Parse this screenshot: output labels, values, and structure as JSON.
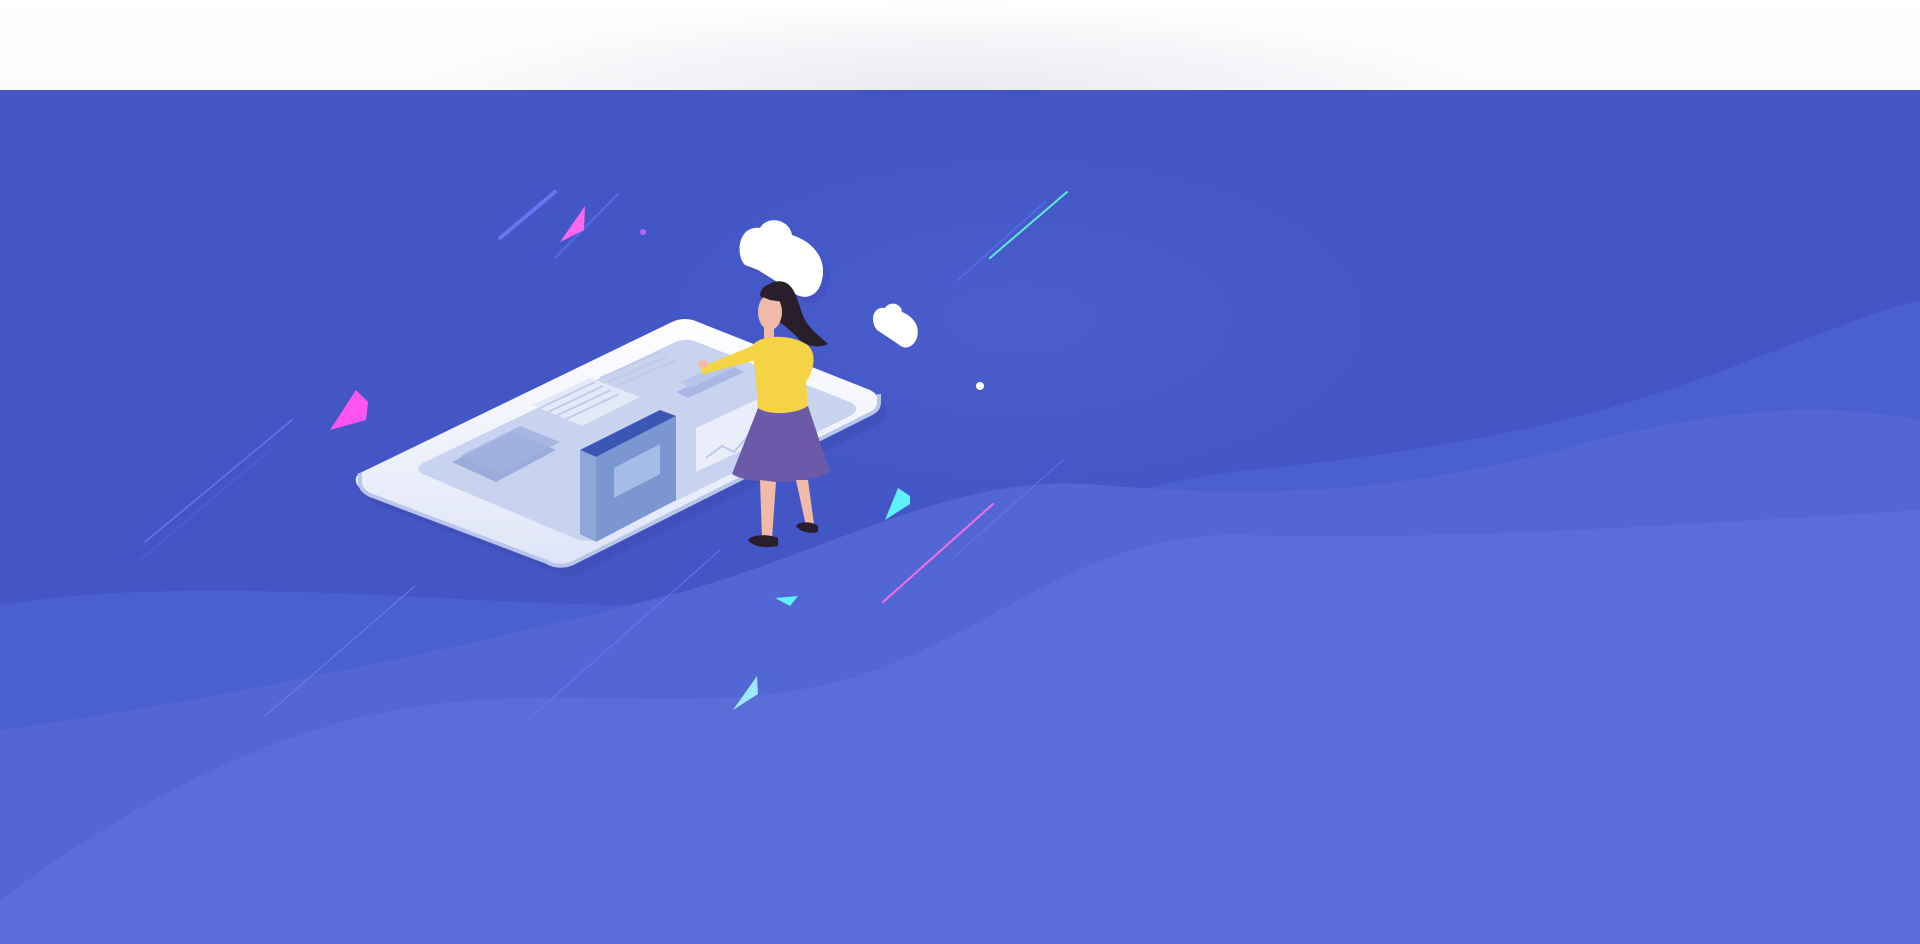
{
  "page": {
    "header": {},
    "hero": {
      "illustration": "woman-standing-on-tablet-illustration",
      "colors": {
        "background": "#4256c6",
        "wave_back": "#4a5fd0",
        "wave_mid": "#5266d4",
        "wave_front": "#5a6ed9",
        "tablet": "#f4f6fc",
        "screen": "#c7d3ef",
        "shirt": "#f4d444",
        "skirt": "#6a5aa8",
        "accent_pink": "#ff5df2",
        "accent_cyan": "#5ef1ff"
      }
    }
  }
}
